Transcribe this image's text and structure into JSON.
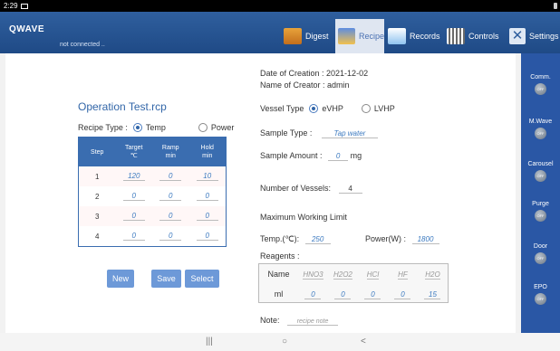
{
  "status_bar": {
    "time": "2:29"
  },
  "header": {
    "brand": "QWAVE",
    "connection": "not connected ..",
    "nav": [
      {
        "label": "Digest"
      },
      {
        "label": "Recipe"
      },
      {
        "label": "Records"
      },
      {
        "label": "Controls"
      },
      {
        "label": "Settings"
      }
    ]
  },
  "recipe": {
    "file_title": "Operation Test.rcp",
    "type_label": "Recipe Type :",
    "type_options": [
      "Temp",
      "Power"
    ],
    "table": {
      "headers": [
        {
          "line1": "Step",
          "line2": ""
        },
        {
          "line1": "Target",
          "line2": "℃"
        },
        {
          "line1": "Ramp",
          "line2": "min"
        },
        {
          "line1": "Hold",
          "line2": "min"
        }
      ],
      "rows": [
        {
          "step": "1",
          "target": "120",
          "ramp": "0",
          "hold": "10"
        },
        {
          "step": "2",
          "target": "0",
          "ramp": "0",
          "hold": "0"
        },
        {
          "step": "3",
          "target": "0",
          "ramp": "0",
          "hold": "0"
        },
        {
          "step": "4",
          "target": "0",
          "ramp": "0",
          "hold": "0"
        }
      ]
    },
    "buttons": {
      "new": "New",
      "save": "Save",
      "select": "Select"
    }
  },
  "details": {
    "date_of_creation": "Date of Creation : 2021-12-02",
    "name_of_creator": "Name of Creator : admin",
    "vessel_type_label": "Vessel Type",
    "vessel_options": [
      "eVHP",
      "LVHP"
    ],
    "sample_type_label": "Sample Type :",
    "sample_type_value": "Tap water",
    "sample_amount_label": "Sample Amount :",
    "sample_amount_value": "0",
    "sample_amount_unit": "mg",
    "num_vessels_label": "Number of Vessels:",
    "num_vessels_value": "4",
    "max_limit_label": "Maximum Working Limit",
    "temp_label": "Temp.(℃):",
    "temp_value": "250",
    "power_label": "Power(W) :",
    "power_value": "1800",
    "reagents_label": "Reagents :",
    "reagents_name_label": "Name",
    "reagents_ml_label": "ml",
    "reagent_names": [
      "HNO3",
      "H2O2",
      "HCl",
      "HF",
      "H2O"
    ],
    "reagent_values": [
      "0",
      "0",
      "0",
      "0",
      "15"
    ],
    "note_label": "Note:",
    "note_placeholder": "recipe note"
  },
  "indicators": [
    {
      "label": "Comm.",
      "state": "OFF"
    },
    {
      "label": "M.Wave",
      "state": "OFF"
    },
    {
      "label": "Carousel",
      "state": "OFF"
    },
    {
      "label": "Purge",
      "state": "OFF"
    },
    {
      "label": "Door",
      "state": "OFF"
    },
    {
      "label": "EPO",
      "state": "OFF"
    }
  ],
  "android_nav": {
    "recents": "|||",
    "home": "○",
    "back": "<"
  }
}
